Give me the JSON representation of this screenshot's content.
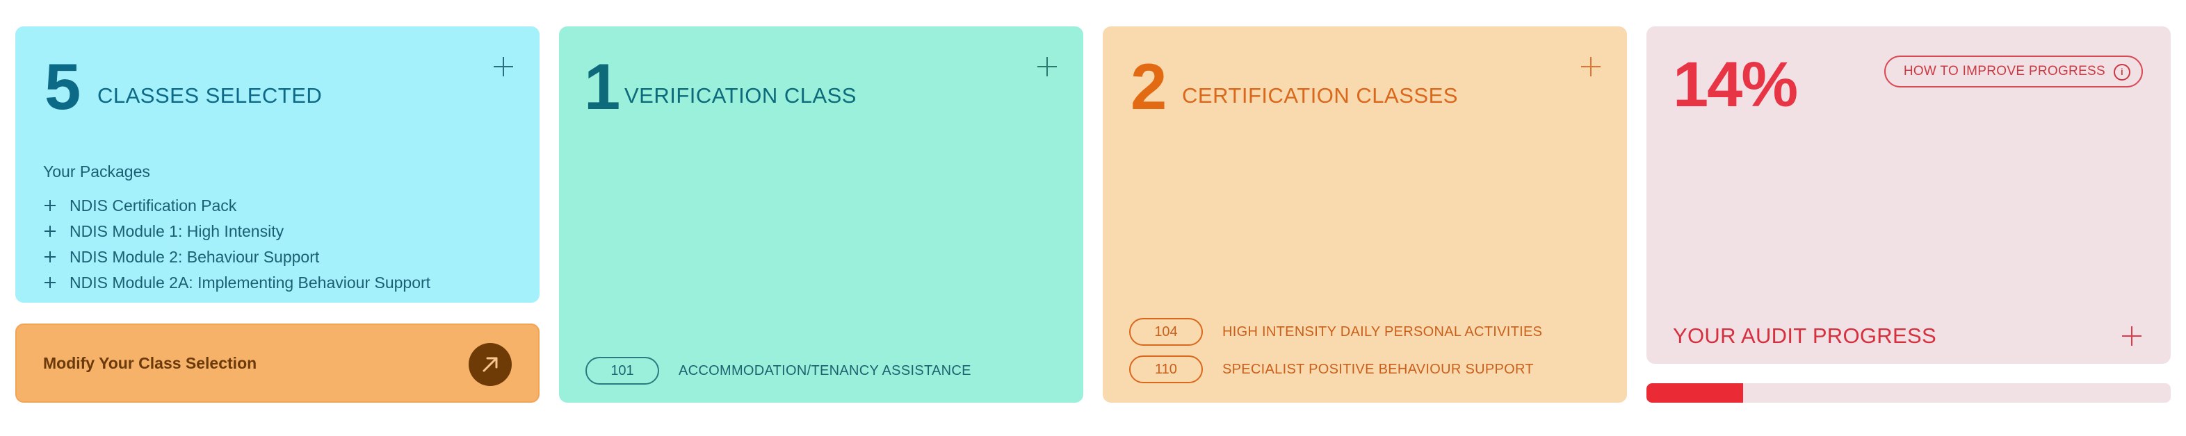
{
  "classes_card": {
    "count": "5",
    "title": "CLASSES SELECTED",
    "packages_heading": "Your Packages",
    "packages": [
      "NDIS Certification Pack",
      "NDIS Module 1: High Intensity",
      "NDIS Module 2: Behaviour Support",
      "NDIS Module 2A: Implementing Behaviour Support"
    ]
  },
  "modify_card": {
    "label": "Modify Your Class Selection",
    "icon": "arrow-up-right-icon"
  },
  "verification_card": {
    "count": "1",
    "title": "VERIFICATION CLASS",
    "classes": [
      {
        "code": "101",
        "name": "ACCOMMODATION/TENANCY ASSISTANCE"
      }
    ]
  },
  "certification_card": {
    "count": "2",
    "title": "CERTIFICATION CLASSES",
    "classes": [
      {
        "code": "104",
        "name": "HIGH INTENSITY DAILY PERSONAL ACTIVITIES"
      },
      {
        "code": "110",
        "name": "SPECIALIST POSITIVE BEHAVIOUR SUPPORT"
      }
    ]
  },
  "audit_card": {
    "percent": "14%",
    "progress_fraction": 0.14,
    "improve_label": "HOW TO IMPROVE PROGRESS",
    "info_icon": "info-icon",
    "title": "YOUR AUDIT PROGRESS"
  },
  "colors": {
    "classes_bg": "#a4f0fb",
    "modify_bg": "#f7b26a",
    "verification_bg": "#9bf0dc",
    "certification_bg": "#f9d9ae",
    "audit_bg": "#f1e1e5",
    "progress_fill": "#ea2b35"
  }
}
